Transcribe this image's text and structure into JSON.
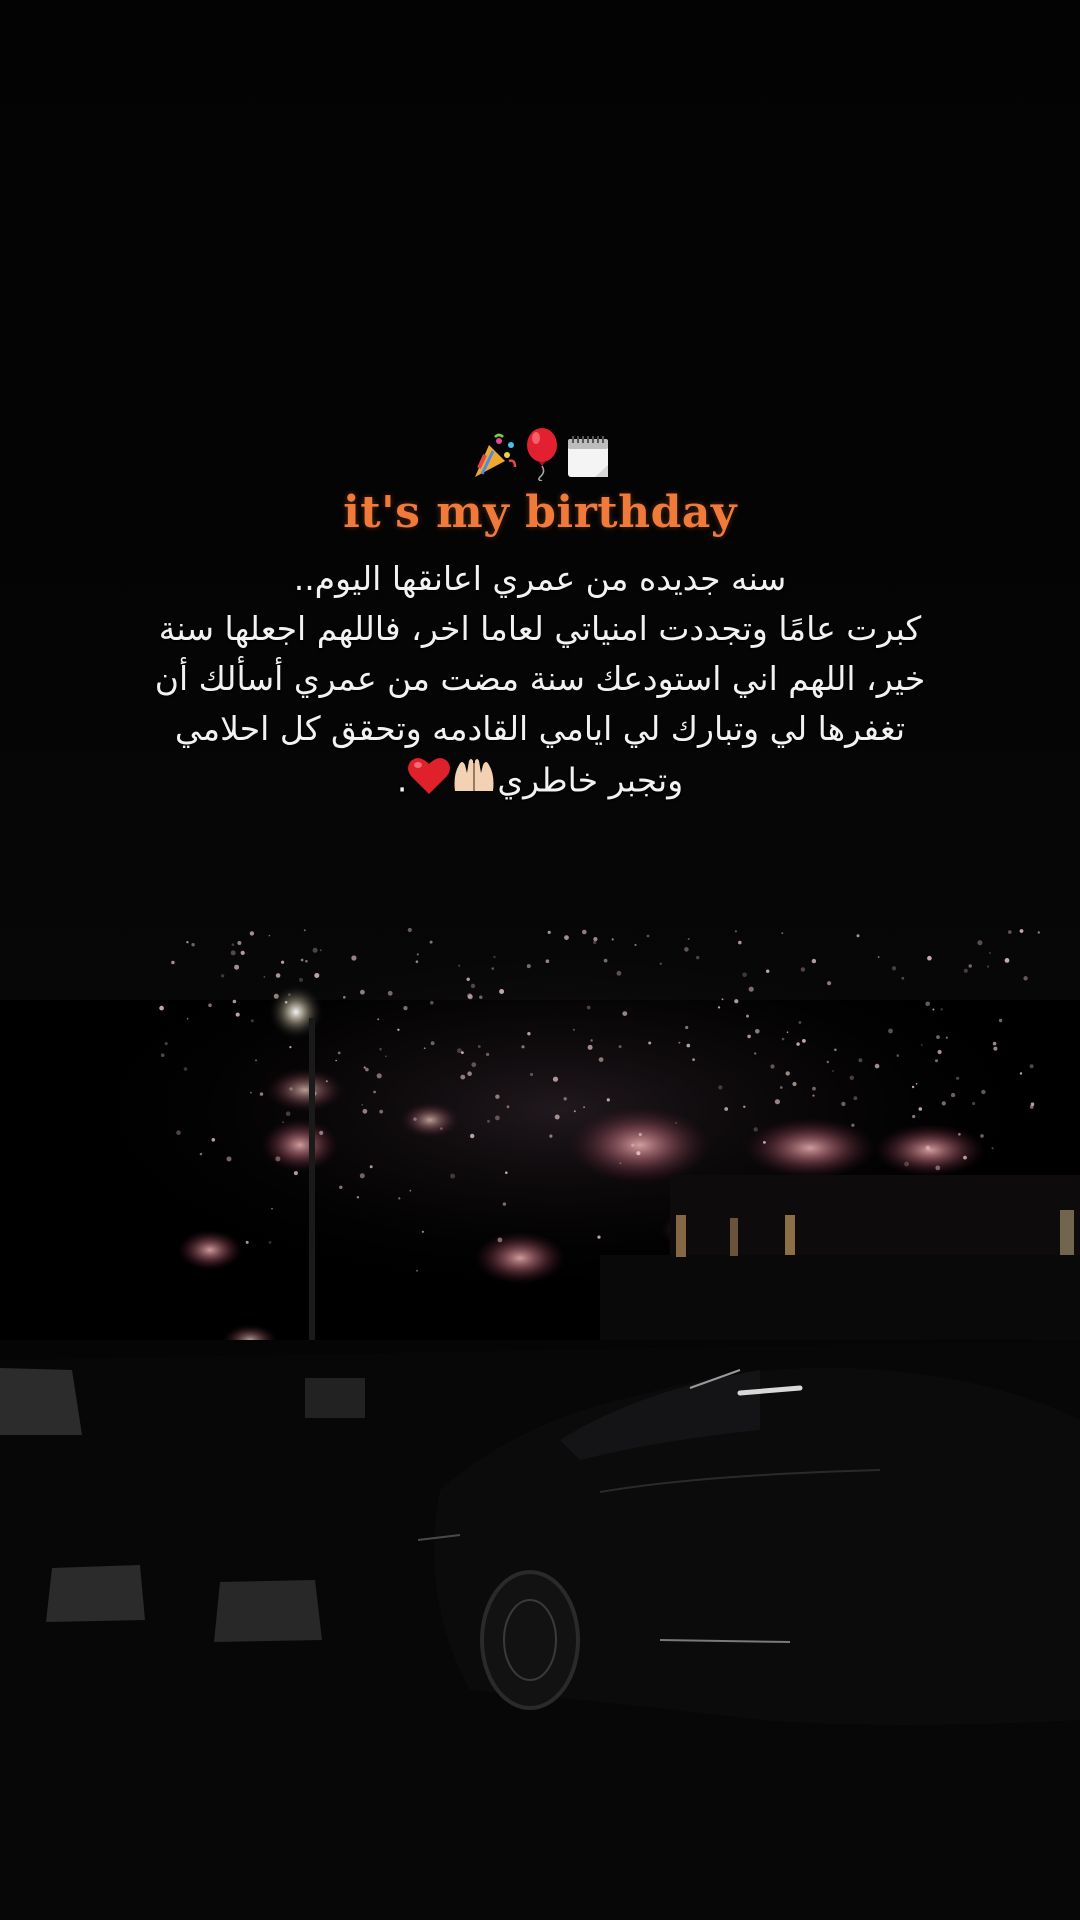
{
  "caption": {
    "title": "it's my birthday",
    "emojis": [
      "party-popper-icon",
      "balloon-icon",
      "calendar-icon"
    ],
    "lines": [
      "سنه جديده من عمري اعانقها اليوم..",
      "كبرت عامًا وتجددت امنياتي لعاما اخر، فاللهم اجعلها سنة",
      "خير، اللهم اني استودعك سنة مضت من عمري أسألك  أن",
      "تغفرها لي وتبارك لي ايامي القادمه وتحقق  كل احلامي",
      "وتجبر خاطري"
    ],
    "line_end_emojis": [
      "raised-hands-icon",
      "red-heart-icon"
    ],
    "trailing_dot": "."
  },
  "colors": {
    "title": "#f07a3a",
    "text": "#f2f2f2",
    "background": "#000000",
    "firework": "#e8a0a8"
  }
}
